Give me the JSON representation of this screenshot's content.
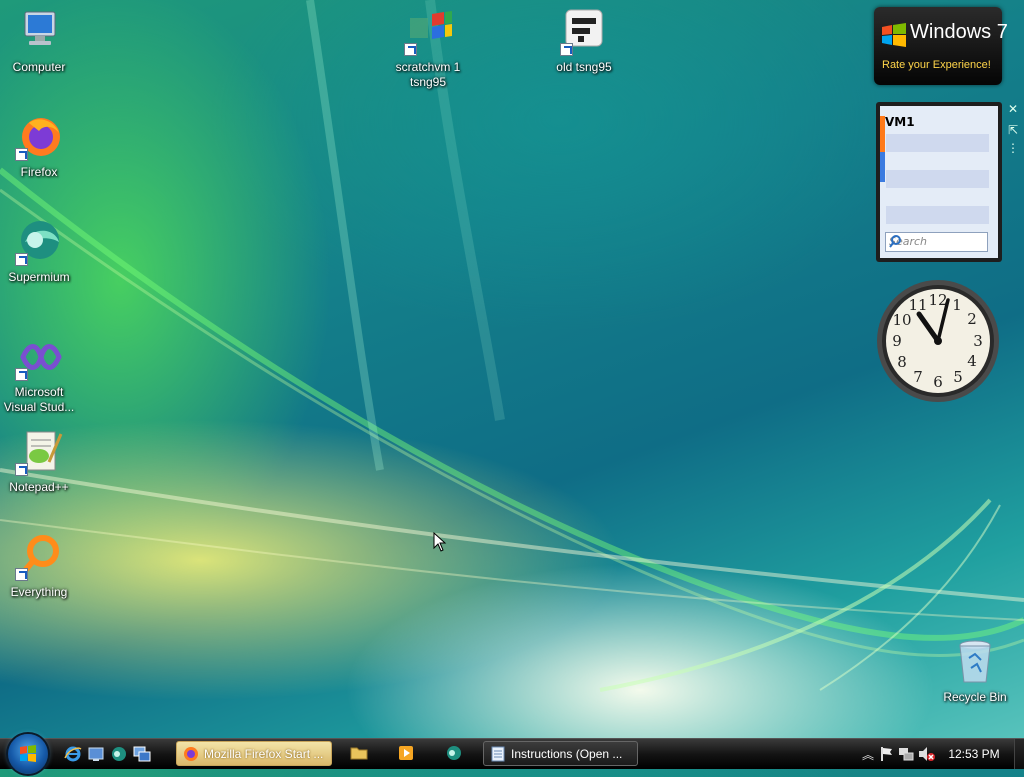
{
  "desktop": {
    "icons": [
      {
        "label": "Computer"
      },
      {
        "label": "Firefox"
      },
      {
        "label": "Supermium"
      },
      {
        "label": "Microsoft Visual Stud..."
      },
      {
        "label": "Notepad++"
      },
      {
        "label": "Everything"
      },
      {
        "label": "scratchvm 1 tsng95"
      },
      {
        "label": "old tsng95"
      },
      {
        "label": "Recycle Bin"
      }
    ]
  },
  "gadgets": {
    "windows7": {
      "title": "Windows 7",
      "subtitle": "Rate your Experience!"
    },
    "feed": {
      "title": "VM1",
      "search_placeholder": "Search"
    },
    "clock": {
      "icon": "analog-clock-icon"
    }
  },
  "taskbar": {
    "start_icon": "windows-orb-icon",
    "quick_launch": [
      "internet-explorer-icon",
      "show-desktop-icon",
      "supermium-icon",
      "switch-windows-icon"
    ],
    "buttons": [
      {
        "label": "Mozilla Firefox Start ...",
        "icon": "firefox-icon",
        "active": true
      },
      {
        "label": "",
        "icon": "folder-icon"
      },
      {
        "label": "",
        "icon": "media-player-icon"
      },
      {
        "label": "",
        "icon": "supermium-icon"
      },
      {
        "label": "Instructions (Open ...",
        "icon": "notepad-icon"
      }
    ],
    "tray": {
      "icons": [
        "show-hidden-icons-icon",
        "action-center-flag-icon",
        "network-icon",
        "volume-muted-icon"
      ],
      "time": "12:53 PM"
    }
  }
}
